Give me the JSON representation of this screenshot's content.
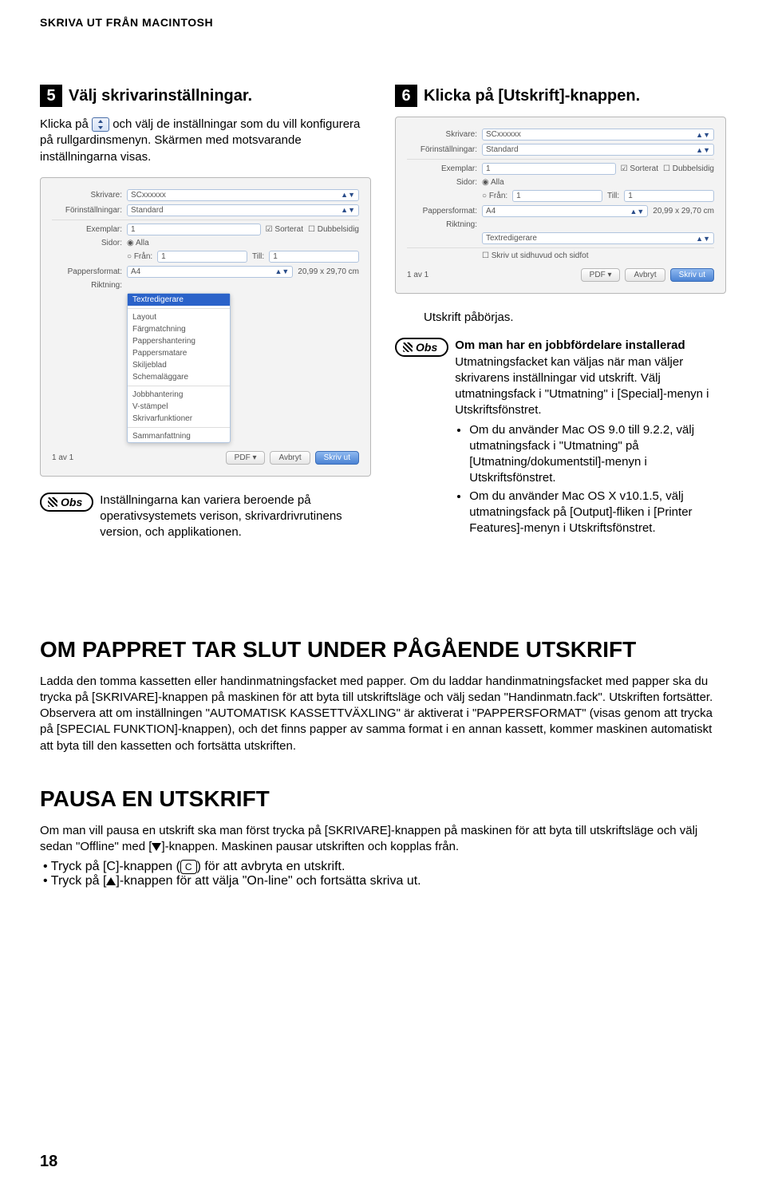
{
  "header": "SKRIVA UT FRÅN MACINTOSH",
  "left": {
    "step_num": "5",
    "step_title": "Välj skrivarinställningar.",
    "para_a": "Klicka på ",
    "para_b": " och välj de inställningar som du vill konfigurera på rullgardinsmenyn. Skärmen med motsvarande inställningarna visas.",
    "dialog1": {
      "rows": {
        "skrivare_lbl": "Skrivare:",
        "skrivare_val": "SCxxxxxx",
        "forinst_lbl": "Förinställningar:",
        "forinst_val": "Standard",
        "exemplar_lbl": "Exemplar:",
        "exemplar_val": "1",
        "sorterat": "Sorterat",
        "dubbel": "Dubbelsidig",
        "sidor_lbl": "Sidor:",
        "alla": "Alla",
        "fran": "Från:",
        "fran_v": "1",
        "till": "Till:",
        "till_v": "1",
        "papper_lbl": "Pappersformat:",
        "papper_val": "A4",
        "papper_dim": "20,99 x 29,70 cm",
        "riktning_lbl": "Riktning:"
      },
      "dropdown_sel": "Textredigerare",
      "dropdown_items": [
        "Layout",
        "Färgmatchning",
        "Pappershantering",
        "Pappersmatare",
        "Skiljeblad",
        "Schemaläggare",
        "Jobbhantering",
        "V-stämpel",
        "Skrivarfunktioner",
        "Sammanfattning"
      ],
      "footer": {
        "pages": "1 av 1",
        "pdf": "PDF",
        "avbryt": "Avbryt",
        "ok": "Skriv ut"
      }
    },
    "obs_label": "Obs",
    "obs_text": "Inställningarna kan variera beroende på operativsystemets verison, skrivardrivrutinens version, och applikationen."
  },
  "right": {
    "step_num": "6",
    "step_title": "Klicka på [Utskrift]-knappen.",
    "dialog2": {
      "rows": {
        "skrivare_lbl": "Skrivare:",
        "skrivare_val": "SCxxxxxx",
        "forinst_lbl": "Förinställningar:",
        "forinst_val": "Standard",
        "exemplar_lbl": "Exemplar:",
        "exemplar_val": "1",
        "sorterat": "Sorterat",
        "dubbel": "Dubbelsidig",
        "sidor_lbl": "Sidor:",
        "alla": "Alla",
        "fran": "Från:",
        "fran_v": "1",
        "till": "Till:",
        "till_v": "1",
        "papper_lbl": "Pappersformat:",
        "papper_val": "A4",
        "papper_dim": "20,99 x 29,70 cm",
        "riktning_lbl": "Riktning:",
        "textredig": "Textredigerare",
        "check_head": "Skriv ut sidhuvud och sidfot"
      },
      "footer": {
        "pages": "1 av 1",
        "pdf": "PDF",
        "avbryt": "Avbryt",
        "ok": "Skriv ut"
      }
    },
    "after_dialog": "Utskrift påbörjas.",
    "obs_label": "Obs",
    "obs_lead": "Om man har en jobbfördelare installerad",
    "obs_p": "Utmatningsfacket kan väljas när man väljer skrivarens inställningar vid utskrift. Välj utmatningsfack i \"Utmatning\" i [Special]-menyn i Utskriftsfönstret.",
    "obs_bullets": [
      "Om du använder Mac OS 9.0 till 9.2.2, välj utmatningsfack i \"Utmatning\" på [Utmatning/dokumentstil]-menyn i Utskriftsfönstret.",
      "Om du använder Mac OS X v10.1.5, välj utmatningsfack på [Output]-fliken i [Printer Features]-menyn i Utskriftsfönstret."
    ]
  },
  "section1": {
    "title": "OM PAPPRET TAR SLUT UNDER PÅGÅENDE UTSKRIFT",
    "p": "Ladda den tomma kassetten eller handinmatningsfacket med papper. Om du laddar handinmatningsfacket med papper ska du trycka på [SKRIVARE]-knappen på maskinen för att byta till utskriftsläge och välj sedan \"Handinmatn.fack\". Utskriften fortsätter. Observera att om inställningen \"AUTOMATISK KASSETTVÄXLING\" är aktiverat i \"PAPPERSFORMAT\" (visas genom att trycka på [SPECIAL FUNKTION]-knappen), och det finns papper av samma format i en annan kassett, kommer maskinen automatiskt att byta till den kassetten och fortsätta utskriften."
  },
  "section2": {
    "title": "PAUSA EN UTSKRIFT",
    "p1a": "Om man vill pausa en utskrift ska man först trycka på [SKRIVARE]-knappen på maskinen för att byta till utskriftsläge och välj sedan \"Offline\" med [",
    "p1b": "]-knappen. Maskinen pausar utskriften och kopplas från.",
    "b1a": "Tryck på [C]-knappen (",
    "b1b": ") för att avbryta en utskrift.",
    "b2a": "Tryck på [",
    "b2b": "]-knappen för att välja \"On-line\" och fortsätta skriva ut.",
    "key_c": "C"
  },
  "page_number": "18"
}
